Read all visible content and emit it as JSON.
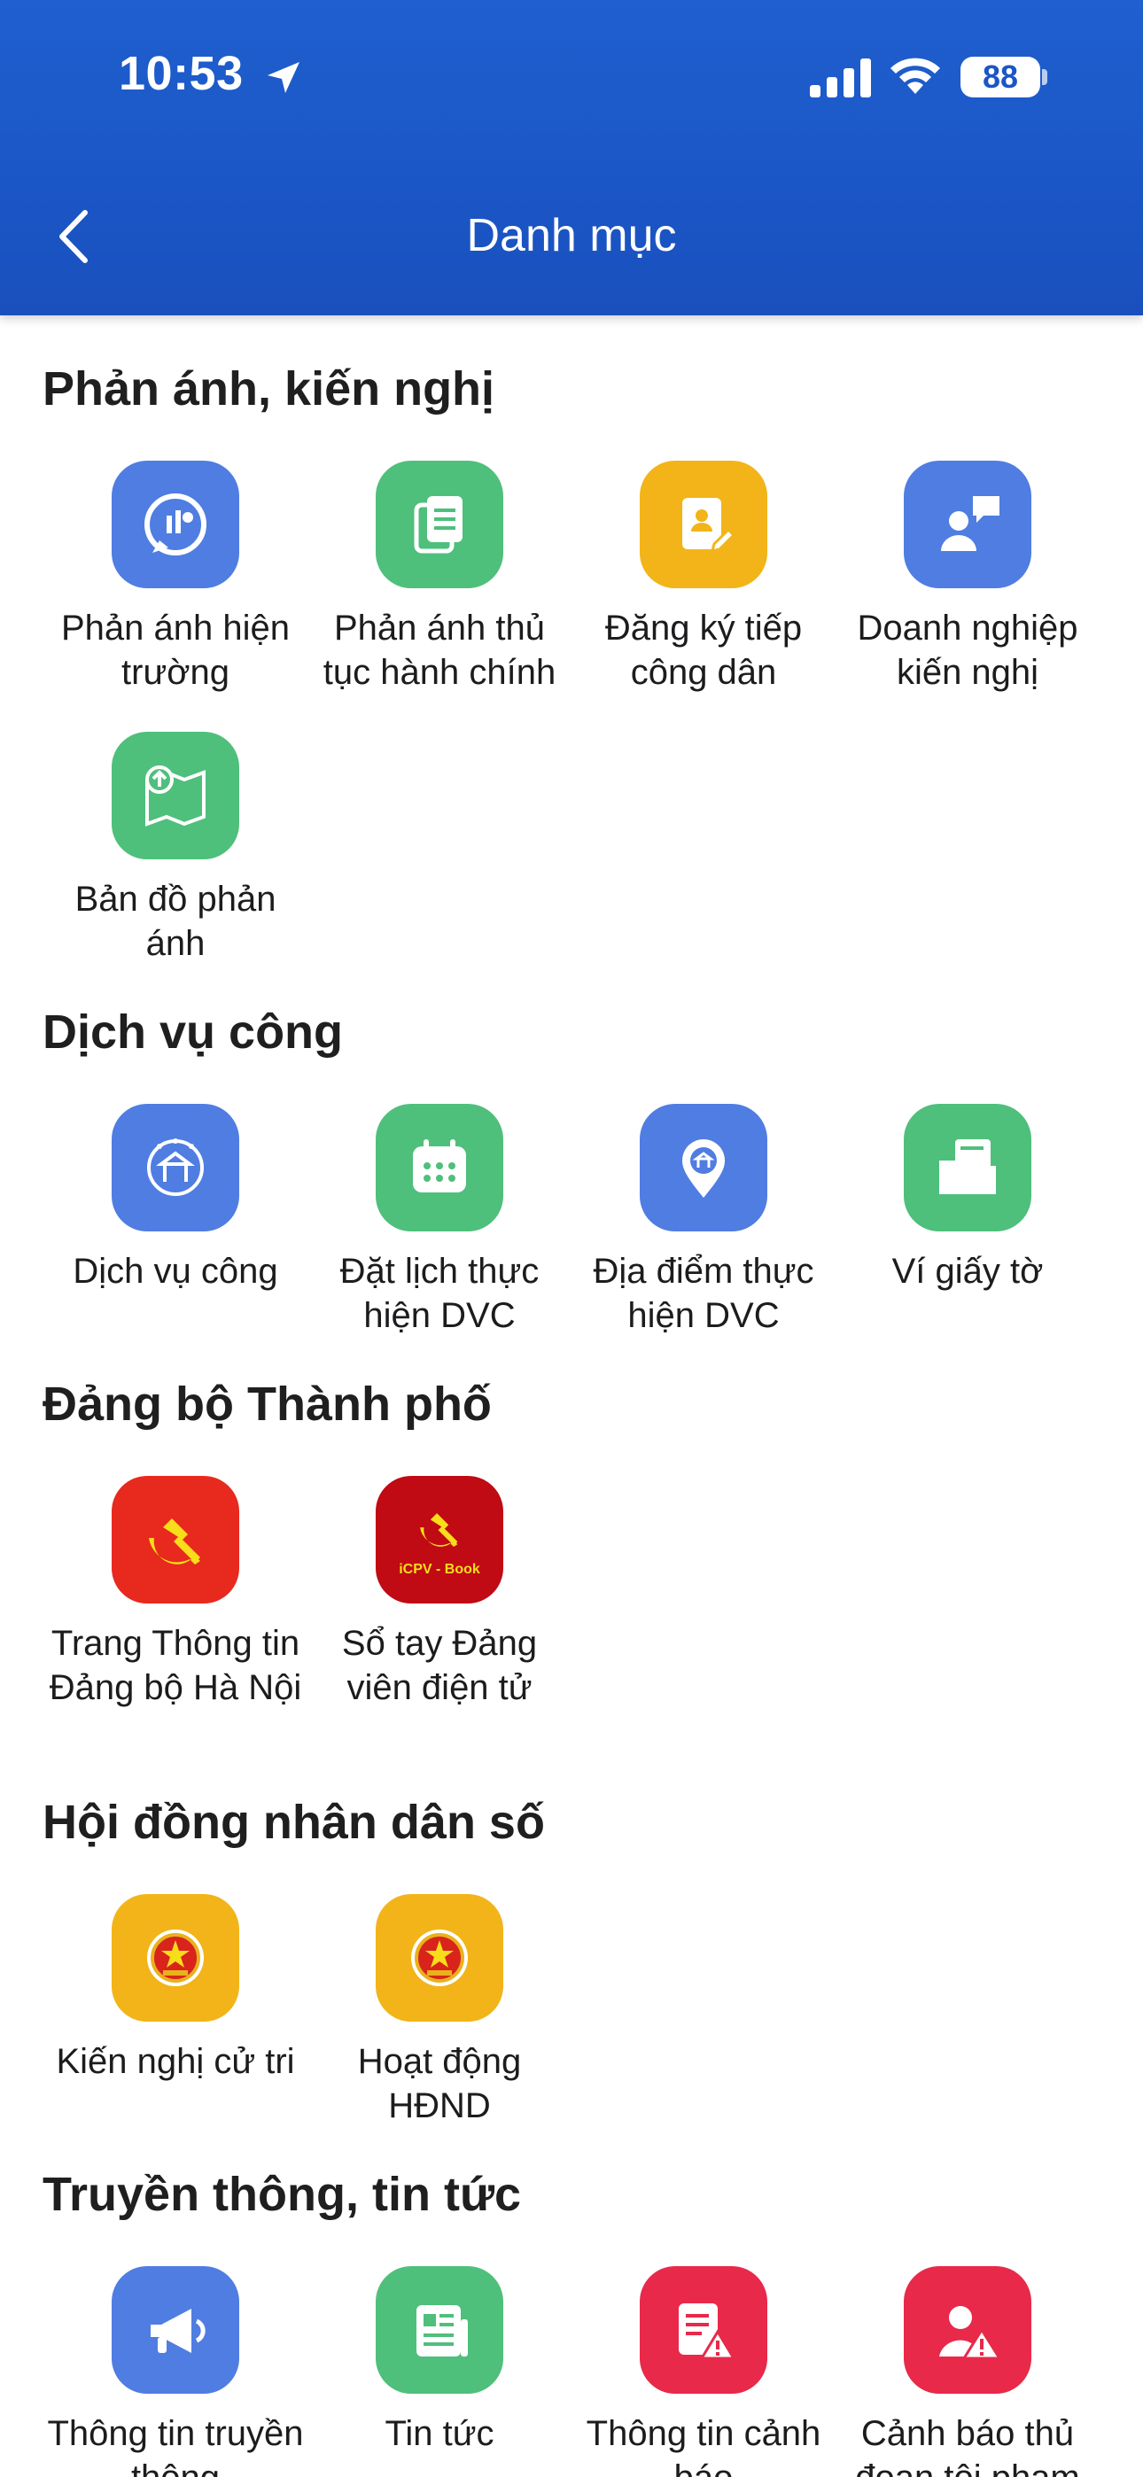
{
  "status_bar": {
    "time": "10:53",
    "battery": "88"
  },
  "header": {
    "title": "Danh mục"
  },
  "sections": [
    {
      "title": "Phản ánh, kiến nghị",
      "items": [
        {
          "label": "Phản ánh hiện trường",
          "icon": "field-report-icon",
          "color": "#4f7de2"
        },
        {
          "label": "Phản ánh thủ tục hành chính",
          "icon": "document-icon",
          "color": "#4fbf7c"
        },
        {
          "label": "Đăng ký tiếp công dân",
          "icon": "citizen-register-icon",
          "color": "#f2b418"
        },
        {
          "label": "Doanh nghiệp kiến nghị",
          "icon": "business-feedback-icon",
          "color": "#4f7de2"
        },
        {
          "label": "Bản đồ phản ánh",
          "icon": "map-upload-icon",
          "color": "#4fbf7c"
        }
      ]
    },
    {
      "title": "Dịch vụ công",
      "items": [
        {
          "label": "Dịch vụ công",
          "icon": "public-service-icon",
          "color": "#4f7de2"
        },
        {
          "label": "Đặt lịch thực hiện DVC",
          "icon": "calendar-icon",
          "color": "#4fbf7c"
        },
        {
          "label": "Địa điểm thực hiện DVC",
          "icon": "location-pin-icon",
          "color": "#4f7de2"
        },
        {
          "label": "Ví giấy tờ",
          "icon": "folder-icon",
          "color": "#4fbf7c"
        }
      ]
    },
    {
      "title": "Đảng bộ Thành phố",
      "items": [
        {
          "label": "Trang Thông tin Đảng bộ Hà Nội",
          "icon": "hammer-sickle-icon",
          "color": "#e8291e"
        },
        {
          "label": "Sổ tay Đảng viên điện tử",
          "icon": "icpv-book-icon",
          "color": "#c00a14",
          "badge": "iCPV - Book"
        }
      ]
    },
    {
      "title": "Hội đồng nhân dân số",
      "items": [
        {
          "label": "Kiến nghị cử tri",
          "icon": "national-emblem-icon",
          "color": "#f2b418"
        },
        {
          "label": "Hoạt động HĐND",
          "icon": "national-emblem-icon",
          "color": "#f2b418"
        }
      ]
    },
    {
      "title": "Truyền thông, tin tức",
      "items": [
        {
          "label": "Thông tin truyền thông",
          "icon": "megaphone-icon",
          "color": "#4f7de2"
        },
        {
          "label": "Tin tức",
          "icon": "newspaper-icon",
          "color": "#4fbf7c"
        },
        {
          "label": "Thông tin cảnh báo",
          "icon": "warning-document-icon",
          "color": "#e8294a"
        },
        {
          "label": "Cảnh báo thủ đoạn tội phạm",
          "icon": "crime-warning-icon",
          "color": "#e8294a"
        }
      ]
    }
  ]
}
